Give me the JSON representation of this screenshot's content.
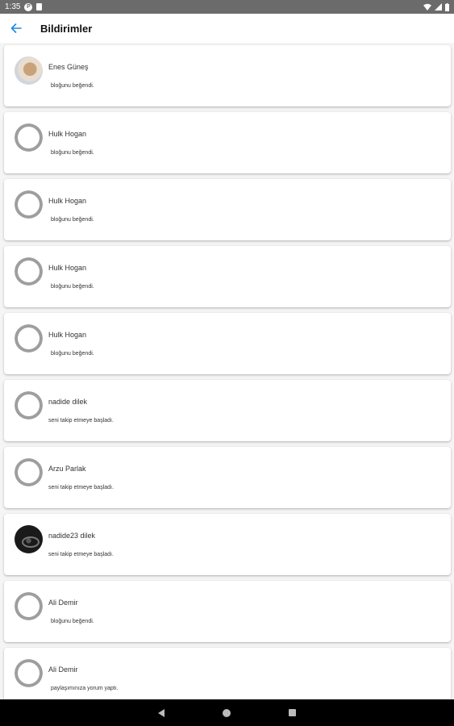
{
  "status_bar": {
    "time": "1:35"
  },
  "header": {
    "title": "Bildirimler"
  },
  "notifications": [
    {
      "user": "Enes Güneş",
      "message": "bloğunu beğendi.",
      "avatar": "photo"
    },
    {
      "user": "Hulk Hogan",
      "message": "bloğunu beğendi.",
      "avatar": "default"
    },
    {
      "user": "Hulk Hogan",
      "message": "bloğunu beğendi.",
      "avatar": "default"
    },
    {
      "user": "Hulk Hogan",
      "message": "bloğunu beğendi.",
      "avatar": "default"
    },
    {
      "user": "Hulk Hogan",
      "message": "bloğunu beğendi.",
      "avatar": "default"
    },
    {
      "user": "nadide dilek",
      "message": "seni takip etmeye başladı.",
      "avatar": "default"
    },
    {
      "user": "Arzu Parlak",
      "message": "seni takip etmeye başladı.",
      "avatar": "default"
    },
    {
      "user": "nadide23 dilek",
      "message": "seni takip etmeye başladı.",
      "avatar": "photo"
    },
    {
      "user": "Ali Demir",
      "message": "bloğunu beğendi.",
      "avatar": "default"
    },
    {
      "user": "Ali Demir",
      "message": "paylaşımınıza yorum yaptı.",
      "avatar": "default"
    }
  ],
  "colors": {
    "status_bar": "#6b6b6b",
    "accent": "#1e88e5",
    "nav_bar": "#000000"
  }
}
